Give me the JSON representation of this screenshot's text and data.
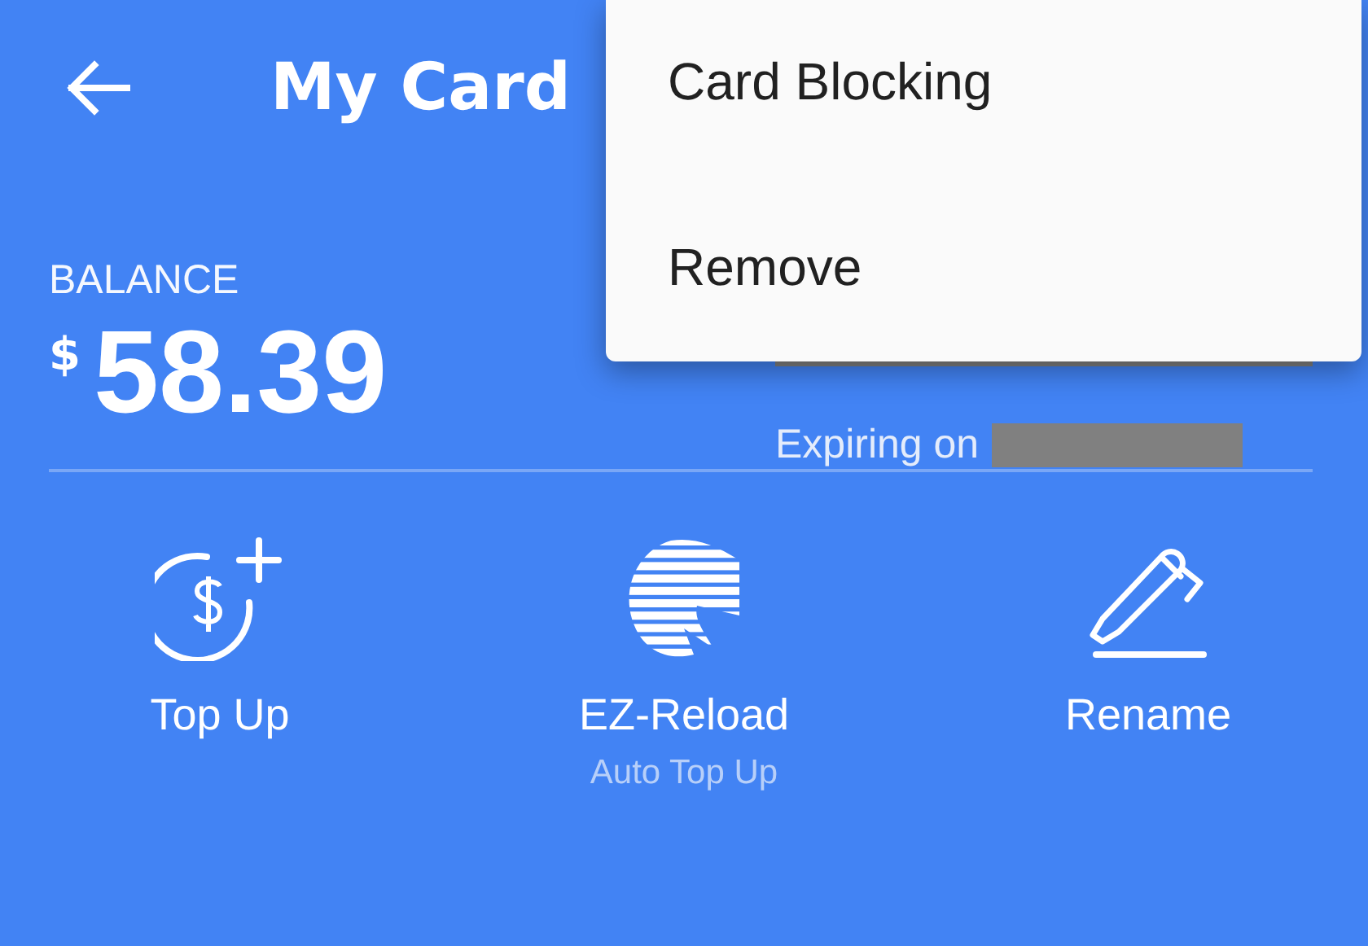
{
  "header": {
    "title": "My Card"
  },
  "balance": {
    "label": "BALANCE",
    "currency": "$",
    "amount": "58.39"
  },
  "card": {
    "expiry_label": "Expiring on"
  },
  "actions": [
    {
      "kind": "topup",
      "label": "Top Up"
    },
    {
      "kind": "reload",
      "label": "EZ-Reload",
      "sublabel": "Auto Top Up"
    },
    {
      "kind": "rename",
      "label": "Rename"
    }
  ],
  "menu": {
    "items": [
      "Card Blocking",
      "Remove"
    ]
  }
}
